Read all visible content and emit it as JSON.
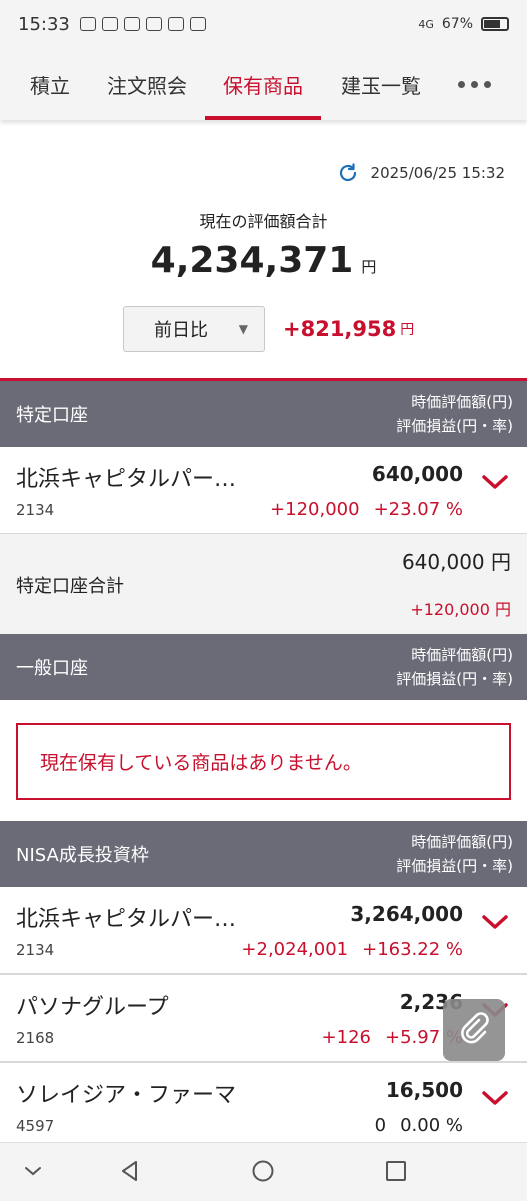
{
  "status_bar": {
    "time": "15:33",
    "network": "4G",
    "battery": "67%",
    "battery_level": 0.67
  },
  "tabs": [
    {
      "label": "積立"
    },
    {
      "label": "注文照会"
    },
    {
      "label": "保有商品",
      "active": true
    },
    {
      "label": "建玉一覧"
    }
  ],
  "summary": {
    "updated_at": "2025/06/25 15:32",
    "total_label": "現在の評価額合計",
    "total_value": "4,234,371",
    "currency": "円",
    "compare_select": "前日比",
    "compare_value": "+821,958"
  },
  "tokutei": {
    "title": "特定口座",
    "col1": "時価評価額(円)",
    "col2": "評価損益(円・率)",
    "holdings": [
      {
        "name": "北浜キャピタルパー…",
        "code": "2134",
        "value": "640,000",
        "pl": "+120,000",
        "rate": "+23.07 %"
      }
    ],
    "subtotal_label": "特定口座合計",
    "subtotal_value": "640,000 円",
    "subtotal_pl": "+120,000 円"
  },
  "ippan": {
    "title": "一般口座",
    "col1": "時価評価額(円)",
    "col2": "評価損益(円・率)",
    "empty_message": "現在保有している商品はありません。"
  },
  "nisa": {
    "title": "NISA成長投資枠",
    "col1": "時価評価額(円)",
    "col2": "評価損益(円・率)",
    "holdings": [
      {
        "name": "北浜キャピタルパー…",
        "code": "2134",
        "value": "3,264,000",
        "pl": "+2,024,001",
        "rate": "+163.22 %"
      },
      {
        "name": "パソナグループ",
        "code": "2168",
        "value": "2,236",
        "pl": "+126",
        "rate": "+5.97 %"
      },
      {
        "name": "ソレイジア・ファーマ",
        "code": "4597",
        "value": "16,500",
        "pl": "0",
        "rate": "0.00 %"
      }
    ]
  },
  "colors": {
    "accent": "#c8102e",
    "header_bg": "#6b6b78"
  },
  "icons": {
    "refresh": "refresh-icon",
    "more": "more-icon",
    "expand": "chevron-down-icon",
    "fab": "attach-icon"
  }
}
